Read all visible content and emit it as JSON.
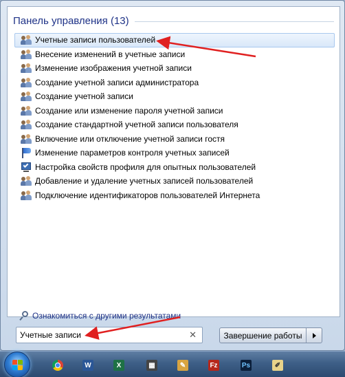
{
  "group": {
    "title": "Панель управления (13)"
  },
  "results": [
    {
      "label": "Учетные записи пользователей",
      "icon": "users-icon",
      "selected": true
    },
    {
      "label": "Внесение изменений в учетные записи",
      "icon": "users-icon"
    },
    {
      "label": "Изменение изображения учетной записи",
      "icon": "users-icon"
    },
    {
      "label": "Создание учетной записи администратора",
      "icon": "users-icon"
    },
    {
      "label": "Создание учетной записи",
      "icon": "users-icon"
    },
    {
      "label": "Создание или изменение пароля учетной записи",
      "icon": "users-icon"
    },
    {
      "label": "Создание стандартной учетной записи пользователя",
      "icon": "users-icon"
    },
    {
      "label": "Включение или отключение учетной записи гостя",
      "icon": "users-icon"
    },
    {
      "label": "Изменение параметров контроля учетных записей",
      "icon": "flag-icon"
    },
    {
      "label": "Настройка свойств профиля для опытных пользователей",
      "icon": "system-profile-icon"
    },
    {
      "label": "Добавление и удаление учетных записей пользователей",
      "icon": "users-icon"
    },
    {
      "label": "Подключение идентификаторов пользователей Интернета",
      "icon": "users-icon"
    }
  ],
  "more_results": {
    "label": "Ознакомиться с другими результатами",
    "icon": "search-icon"
  },
  "search": {
    "value": "Учетные записи",
    "clear_icon": "close-icon"
  },
  "shutdown": {
    "label": "Завершение работы",
    "arrow_icon": "chevron-right-icon"
  },
  "taskbar": {
    "start_icon": "windows-start-orb-icon",
    "apps": [
      {
        "name": "chrome-icon",
        "glyph": ""
      },
      {
        "name": "word-icon",
        "glyph": "W"
      },
      {
        "name": "excel-icon",
        "glyph": "X"
      },
      {
        "name": "calculator-icon",
        "glyph": "▦"
      },
      {
        "name": "paint-icon",
        "glyph": "✎"
      },
      {
        "name": "filezilla-icon",
        "glyph": "Fz"
      },
      {
        "name": "photoshop-icon",
        "glyph": "Ps"
      },
      {
        "name": "sticky-notes-icon",
        "glyph": "✐"
      }
    ]
  },
  "colors": {
    "accent": "#1e3287",
    "annotation_arrow": "#e02020",
    "selection": "#d9e8f9"
  }
}
